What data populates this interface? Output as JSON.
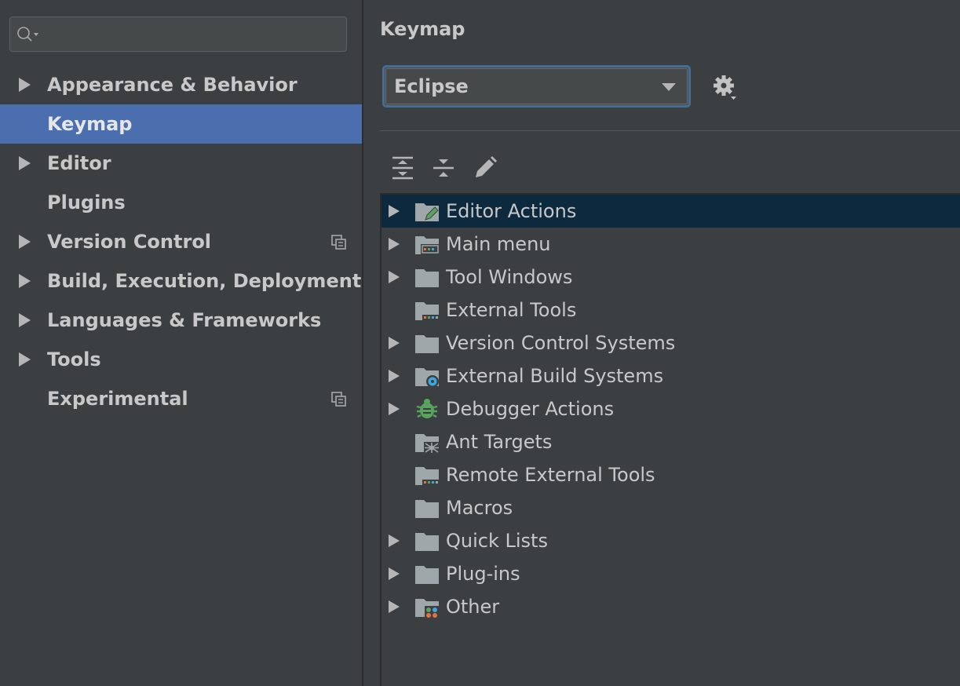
{
  "sidebar": {
    "search": {
      "placeholder": "",
      "value": ""
    },
    "items": [
      {
        "label": "Appearance & Behavior",
        "expandable": true,
        "selected": false,
        "project_scoped": false
      },
      {
        "label": "Keymap",
        "expandable": false,
        "selected": true,
        "project_scoped": false
      },
      {
        "label": "Editor",
        "expandable": true,
        "selected": false,
        "project_scoped": false
      },
      {
        "label": "Plugins",
        "expandable": false,
        "selected": false,
        "project_scoped": false
      },
      {
        "label": "Version Control",
        "expandable": true,
        "selected": false,
        "project_scoped": true
      },
      {
        "label": "Build, Execution, Deployment",
        "expandable": true,
        "selected": false,
        "project_scoped": false
      },
      {
        "label": "Languages & Frameworks",
        "expandable": true,
        "selected": false,
        "project_scoped": false
      },
      {
        "label": "Tools",
        "expandable": true,
        "selected": false,
        "project_scoped": false
      },
      {
        "label": "Experimental",
        "expandable": false,
        "selected": false,
        "project_scoped": true
      }
    ]
  },
  "panel": {
    "title": "Keymap",
    "keymap_select": {
      "value": "Eclipse"
    },
    "toolbar": [
      {
        "icon": "expand-all-icon"
      },
      {
        "icon": "collapse-all-icon"
      },
      {
        "icon": "edit-icon"
      }
    ],
    "tree": [
      {
        "label": "Editor Actions",
        "icon": "editor-actions-icon",
        "expandable": true,
        "selected": true
      },
      {
        "label": "Main menu",
        "icon": "main-menu-icon",
        "expandable": true,
        "selected": false
      },
      {
        "label": "Tool Windows",
        "icon": "folder-icon",
        "expandable": true,
        "selected": false
      },
      {
        "label": "External Tools",
        "icon": "external-tools-icon",
        "expandable": false,
        "selected": false
      },
      {
        "label": "Version Control Systems",
        "icon": "folder-icon",
        "expandable": true,
        "selected": false
      },
      {
        "label": "External Build Systems",
        "icon": "build-systems-icon",
        "expandable": true,
        "selected": false
      },
      {
        "label": "Debugger Actions",
        "icon": "bug-icon",
        "expandable": true,
        "selected": false
      },
      {
        "label": "Ant Targets",
        "icon": "ant-icon",
        "expandable": false,
        "selected": false
      },
      {
        "label": "Remote External Tools",
        "icon": "external-tools-icon",
        "expandable": false,
        "selected": false
      },
      {
        "label": "Macros",
        "icon": "folder-icon",
        "expandable": false,
        "selected": false
      },
      {
        "label": "Quick Lists",
        "icon": "folder-icon",
        "expandable": true,
        "selected": false
      },
      {
        "label": "Plug-ins",
        "icon": "folder-icon",
        "expandable": true,
        "selected": false
      },
      {
        "label": "Other",
        "icon": "other-icon",
        "expandable": true,
        "selected": false
      }
    ]
  },
  "colors": {
    "background": "#3c3f41",
    "selection": "#4b6eaf",
    "tree_selection": "#0d293e",
    "focus_border": "#466d94",
    "text": "#c8c8c8",
    "folder": "#a0a7ab",
    "accent_green": "#58a45c",
    "accent_blue": "#40a6e0",
    "accent_orange": "#e3723c"
  }
}
